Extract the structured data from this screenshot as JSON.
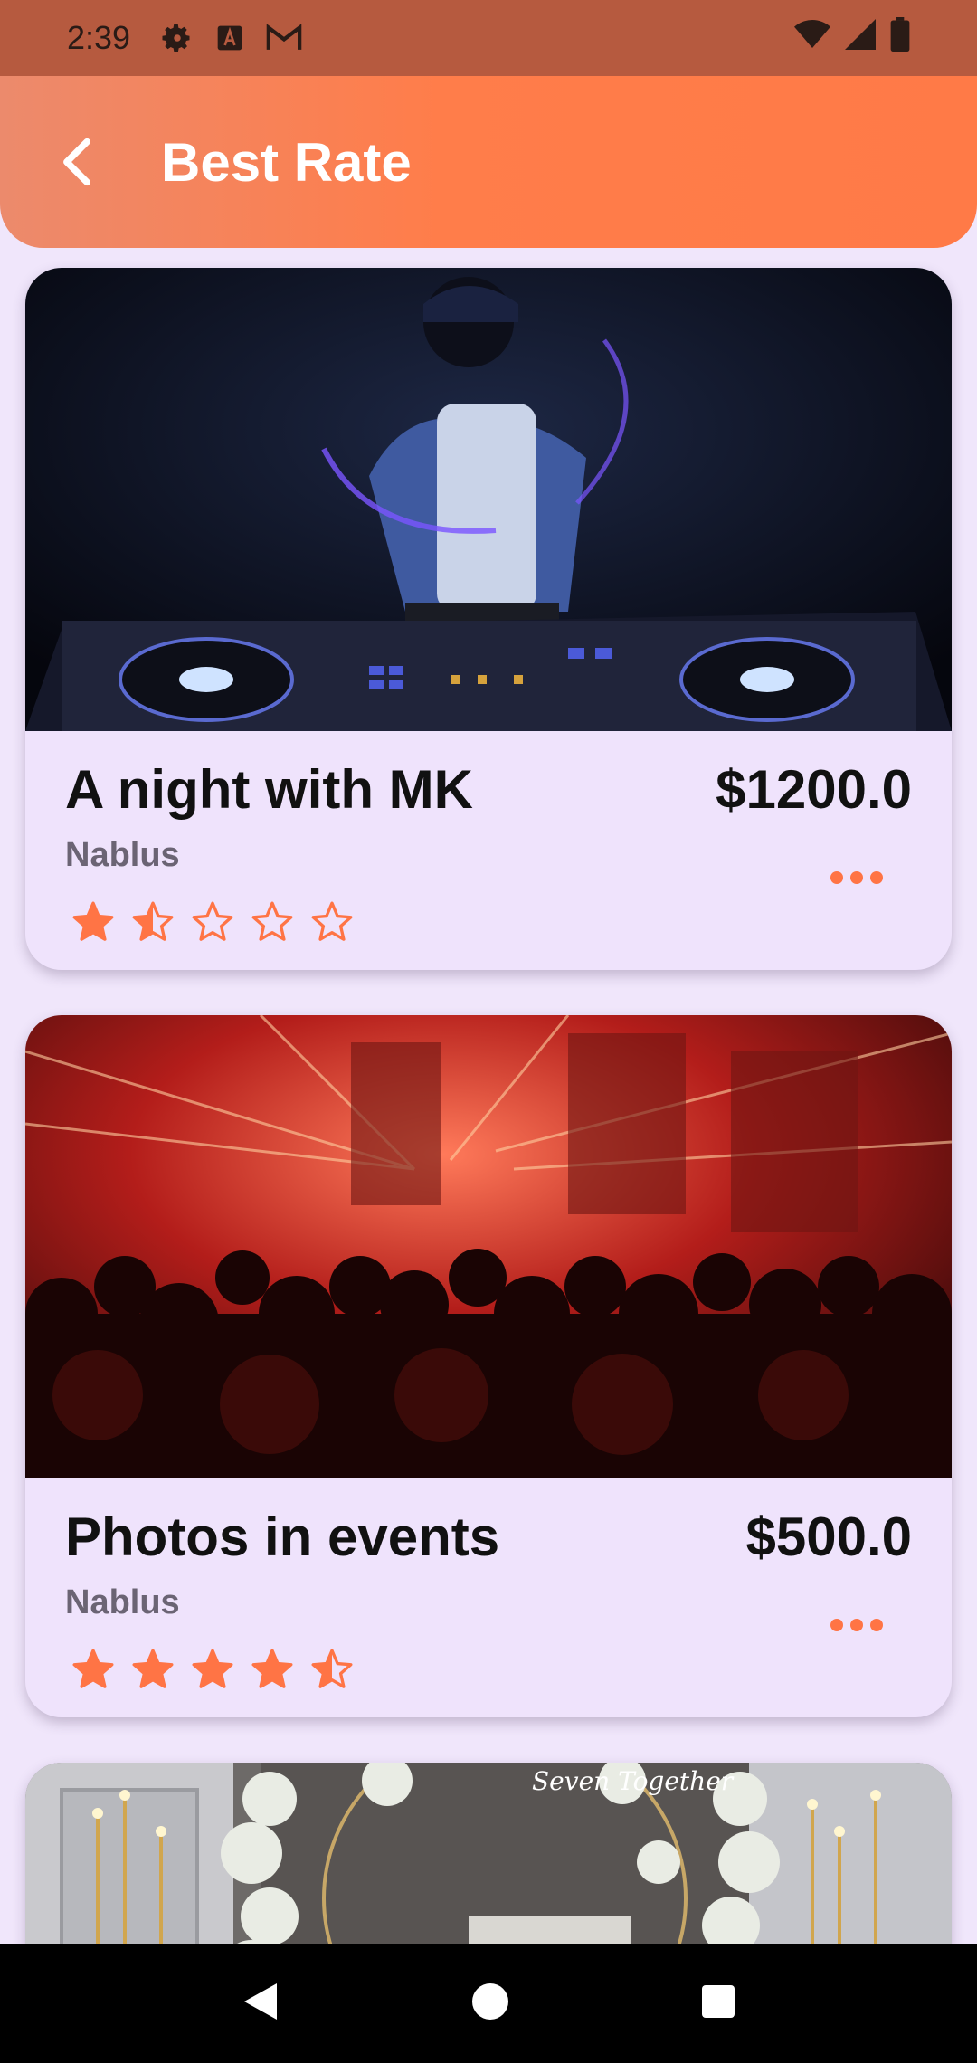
{
  "status_bar": {
    "time": "2:39",
    "icons": [
      "settings-icon",
      "a-icon",
      "gmail-icon",
      "wifi-icon",
      "signal-icon",
      "battery-icon"
    ]
  },
  "app_bar": {
    "title": "Best Rate",
    "back_icon": "chevron-left-icon"
  },
  "cards": [
    {
      "title": "A night with MK",
      "price": "$1200.0",
      "city": "Nablus",
      "rating": 1.5,
      "image": "dj-mixing-photo"
    },
    {
      "title": "Photos in events",
      "price": "$500.0",
      "city": "Nablus",
      "rating": 4.5,
      "image": "concert-crowd-photo"
    },
    {
      "title": "",
      "price": "",
      "city": "",
      "rating": null,
      "image": "wedding-decor-photo"
    }
  ],
  "nav_bar": {
    "icons": [
      "back-triangle-icon",
      "home-circle-icon",
      "recents-square-icon"
    ]
  },
  "colors": {
    "accent": "#ff7445",
    "card_bg": "#efe3fc",
    "page_bg": "#f0e6fb",
    "status_bg": "#b65a3f"
  }
}
